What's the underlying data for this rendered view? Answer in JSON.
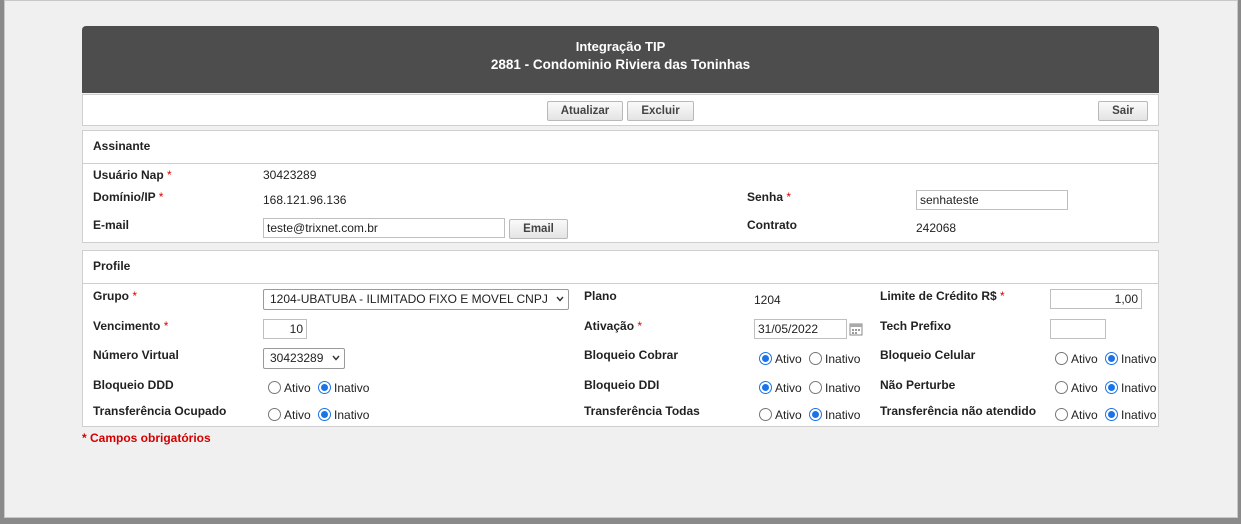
{
  "header": {
    "title": "Integração TIP",
    "subtitle": "2881 - Condominio Riviera das Toninhas"
  },
  "toolbar": {
    "update_label": "Atualizar",
    "delete_label": "Excluir",
    "exit_label": "Sair"
  },
  "assinante": {
    "section_title": "Assinante",
    "usuario_label": "Usuário Nap",
    "usuario_value": "30423289",
    "dominio_label": "Domínio/IP",
    "dominio_value": "168.121.96.136",
    "email_label": "E-mail",
    "email_value": "teste@trixnet.com.br",
    "email_button": "Email",
    "senha_label": "Senha",
    "senha_value": "senhateste",
    "contrato_label": "Contrato",
    "contrato_value": "242068"
  },
  "profile": {
    "section_title": "Profile",
    "grupo_label": "Grupo",
    "grupo_value": "1204-UBATUBA - ILIMITADO FIXO E MOVEL CNPJ",
    "plano_label": "Plano",
    "plano_value": "1204",
    "limite_label": "Limite de Crédito R$",
    "limite_value": "1,00",
    "vencimento_label": "Vencimento",
    "vencimento_value": "10",
    "ativacao_label": "Ativação",
    "ativacao_value": "31/05/2022",
    "tech_label": "Tech Prefixo",
    "tech_value": "",
    "numero_label": "Número Virtual",
    "numero_value": "30423289",
    "bloq_cobrar_label": "Bloqueio Cobrar",
    "bloq_celular_label": "Bloqueio Celular",
    "bloq_ddd_label": "Bloqueio DDD",
    "bloq_ddi_label": "Bloqueio DDI",
    "nao_perturbe_label": "Não Perturbe",
    "transf_ocupado_label": "Transferência Ocupado",
    "transf_todas_label": "Transferência Todas",
    "transf_nao_atendido_label": "Transferência não atendido",
    "ativo": "Ativo",
    "inativo": "Inativo",
    "radio_states": {
      "bloq_cobrar": "Ativo",
      "bloq_celular": "Inativo",
      "bloq_ddd": "Inativo",
      "bloq_ddi": "Ativo",
      "nao_perturbe": "Inativo",
      "transf_ocupado": "Inativo",
      "transf_todas": "Inativo",
      "transf_nao_atendido": "Inativo"
    }
  },
  "required_mark": "*",
  "footnote": "* Campos obrigatórios",
  "colors": {
    "header_bg": "#4d4d4d",
    "required": "#d00000",
    "radio_accent": "#1a73e8"
  }
}
